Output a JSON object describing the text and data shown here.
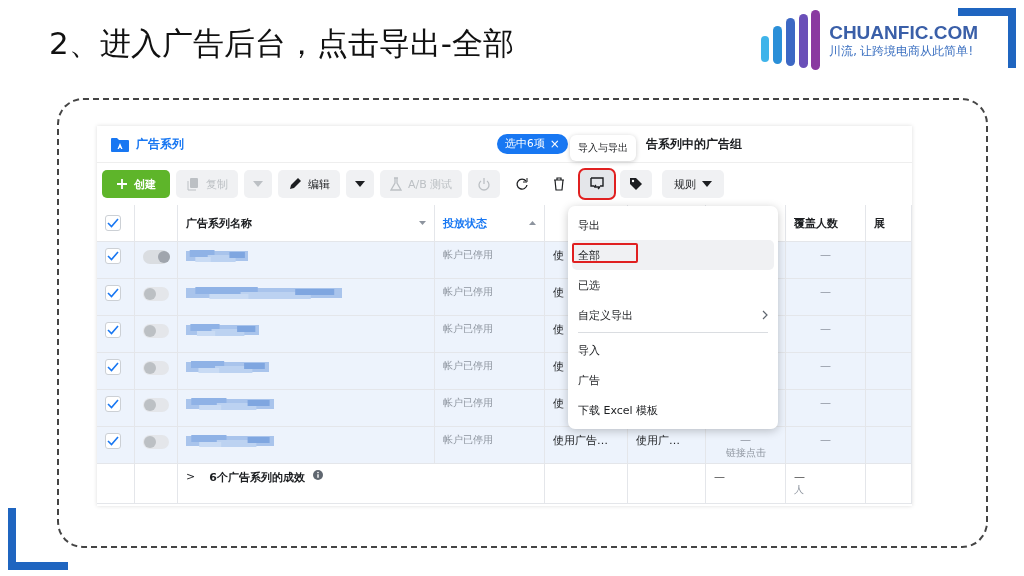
{
  "slide": {
    "title": "2、进入广告后台，点击导出-全部",
    "logo": {
      "name": "CHUANFIC.COM",
      "tagline": "川流, 让跨境电商从此简单!"
    }
  },
  "app": {
    "section_title": "广告系列",
    "selection_chip": {
      "label": "选中6项",
      "close": "×"
    },
    "tooltip": "导入与导出",
    "tab_partial": "告系列中的广告组",
    "toolbar": [
      {
        "kind": "create",
        "label": "创建",
        "disabled": false,
        "highlighted": false
      },
      {
        "kind": "copy",
        "label": "复制",
        "disabled": true,
        "highlighted": false
      },
      {
        "kind": "caret",
        "disabled": true,
        "highlighted": false
      },
      {
        "kind": "edit",
        "label": "编辑",
        "disabled": false,
        "highlighted": false
      },
      {
        "kind": "caret",
        "disabled": false,
        "highlighted": false
      },
      {
        "kind": "abtest",
        "label": "A/B 测试",
        "disabled": true,
        "highlighted": false
      },
      {
        "kind": "power",
        "disabled": true,
        "highlighted": false
      },
      {
        "kind": "refresh",
        "disabled": false,
        "highlighted": false
      },
      {
        "kind": "trash",
        "disabled": false,
        "highlighted": false
      },
      {
        "kind": "export",
        "disabled": false,
        "highlighted": true
      },
      {
        "kind": "tag",
        "disabled": false,
        "highlighted": false
      },
      {
        "kind": "rules",
        "label": "规则",
        "disabled": false,
        "highlighted": false
      }
    ],
    "table": {
      "all_checked": true,
      "columns": [
        {
          "kind": "label",
          "label": "广告系列名称",
          "sorted": false
        },
        {
          "kind": "label",
          "label": "投放状态",
          "sorted": true
        },
        {
          "kind": "hidden"
        },
        {
          "kind": "hidden"
        },
        {
          "kind": "hidden"
        },
        {
          "kind": "label",
          "label": "覆盖人数"
        },
        {
          "kind": "label",
          "label": "展"
        }
      ],
      "rows": [
        {
          "checked": true,
          "on": true,
          "status": "帐户已停用",
          "column_3": "使",
          "reach": "—"
        },
        {
          "checked": true,
          "on": false,
          "status": "帐户已停用",
          "column_3": "使",
          "reach": "—"
        },
        {
          "checked": true,
          "on": false,
          "status": "帐户已停用",
          "column_3": "使",
          "reach": "—"
        },
        {
          "checked": true,
          "on": false,
          "status": "帐户已停用",
          "column_3": "使",
          "reach": "—"
        },
        {
          "checked": true,
          "on": false,
          "status": "帐户已停用",
          "column_3": "使",
          "reach": "—"
        },
        {
          "checked": true,
          "on": false,
          "status": "帐户已停用",
          "column_3": "使用广告…",
          "column_4": "使用广…",
          "column_5": {
            "value": "—",
            "sub": "链接点击"
          },
          "reach": "—"
        }
      ],
      "summary": {
        "expand": ">",
        "label": "6个广告系列的成效",
        "column_5": "—",
        "reach": "—",
        "reach_unit": "人"
      }
    },
    "menu": [
      {
        "kind": "header",
        "label": "导出"
      },
      {
        "kind": "item",
        "label": "全部",
        "hovered": true,
        "highlighted": true
      },
      {
        "kind": "item",
        "label": "已选",
        "hovered": false,
        "highlighted": false
      },
      {
        "kind": "submenu",
        "label": "自定义导出",
        "hovered": false,
        "highlighted": false
      },
      {
        "kind": "divider"
      },
      {
        "kind": "header",
        "label": "导入"
      },
      {
        "kind": "item",
        "label": "广告",
        "hovered": false,
        "highlighted": false
      },
      {
        "kind": "item",
        "label": "下载 Excel 模板",
        "hovered": false,
        "highlighted": false
      }
    ]
  }
}
